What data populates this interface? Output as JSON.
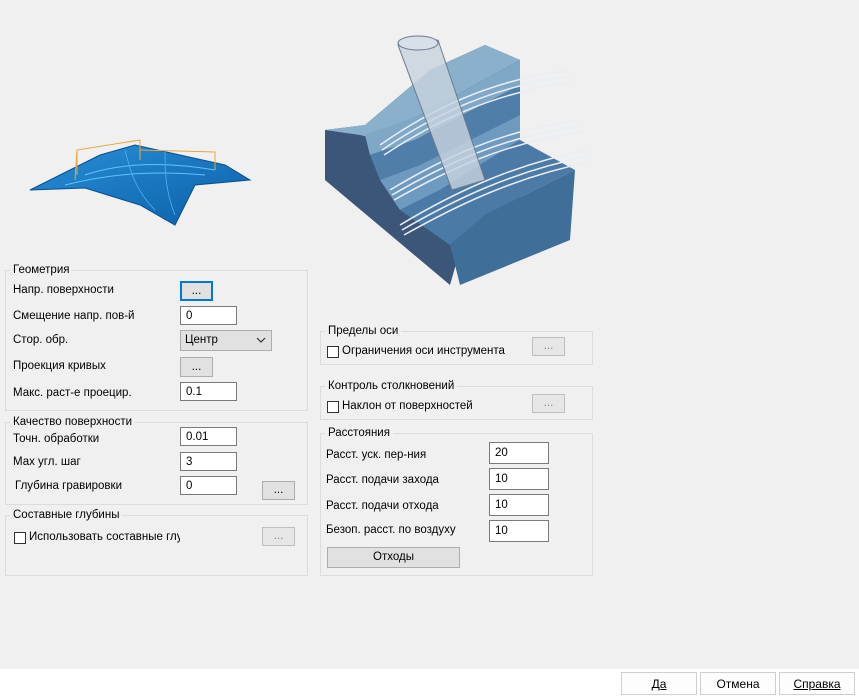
{
  "geometry": {
    "title": "Геометрия",
    "surface_dir_label": "Напр. поверхности",
    "surface_dir_btn": "...",
    "offset_label": "Смещение напр. пов-й",
    "offset_value": "0",
    "side_label": "Стор. обр.",
    "side_value": "Центр",
    "curve_proj_label": "Проекция кривых",
    "curve_proj_btn": "...",
    "max_proj_label": "Макс. раст-е проецир.",
    "max_proj_value": "0.1"
  },
  "quality": {
    "title": "Качество поверхности",
    "accuracy_label": "Точн. обработки",
    "accuracy_value": "0.01",
    "max_angle_label": "Мах угл. шаг",
    "max_angle_value": "3",
    "engrave_depth_label": "Глубина гравировки",
    "engrave_depth_value": "0",
    "engrave_btn": "..."
  },
  "multi_depth": {
    "title": "Составные глубины",
    "use_label": "Использовать составные глуб",
    "btn": "..."
  },
  "axis_limits": {
    "title": "Пределы оси",
    "tool_axis_label": "Ограничения оси инструмента",
    "btn": "..."
  },
  "collision": {
    "title": "Контроль столкновений",
    "tilt_label": "Наклон от поверхностей",
    "btn": "..."
  },
  "distances": {
    "title": "Расстояния",
    "rapid_label": "Расст. уск. пер-ния",
    "rapid_value": "20",
    "lead_in_label": "Расст. подачи захода",
    "lead_in_value": "10",
    "lead_out_label": "Расст. подачи отхода",
    "lead_out_value": "10",
    "safe_label": "Безоп. расст. по воздуху",
    "safe_value": "10",
    "retracts_btn": "Отходы"
  },
  "footer": {
    "ok": "Да",
    "cancel": "Отмена",
    "help": "Справка"
  }
}
